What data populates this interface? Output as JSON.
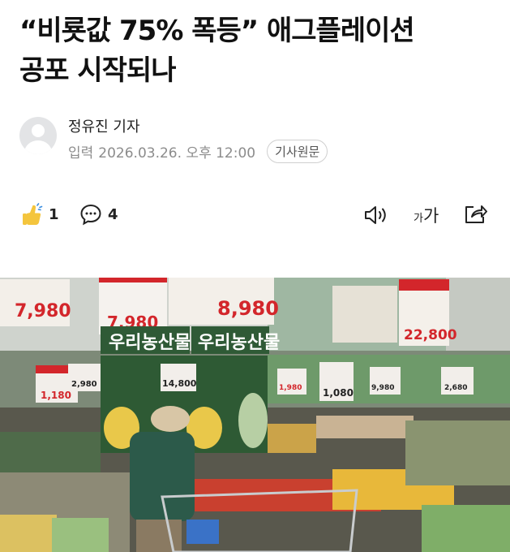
{
  "article": {
    "headline_line1": "“비룟값 75% 폭등” 애그플레이션",
    "headline_line2": "공포 시작되나",
    "reporter": "정유진 기자",
    "date_label": "입력",
    "date": "2026.03.26. 오후 12:00",
    "original_button": "기사원문"
  },
  "actions": {
    "like_count": "1",
    "comment_count": "4",
    "font_small": "가",
    "font_big": "가"
  },
  "photo": {
    "price_tags": [
      "7,980",
      "7,980",
      "8,980",
      "22,800",
      "1,180",
      "2,980",
      "14,800",
      "1,980",
      "1,080",
      "9,980",
      "2,680"
    ],
    "banners": [
      "우리농산물",
      "우리농산물"
    ]
  },
  "colors": {
    "text": "#111111",
    "muted": "#8c8c8c",
    "price_red": "#d3262b",
    "like_yellow": "#f4c53d"
  }
}
